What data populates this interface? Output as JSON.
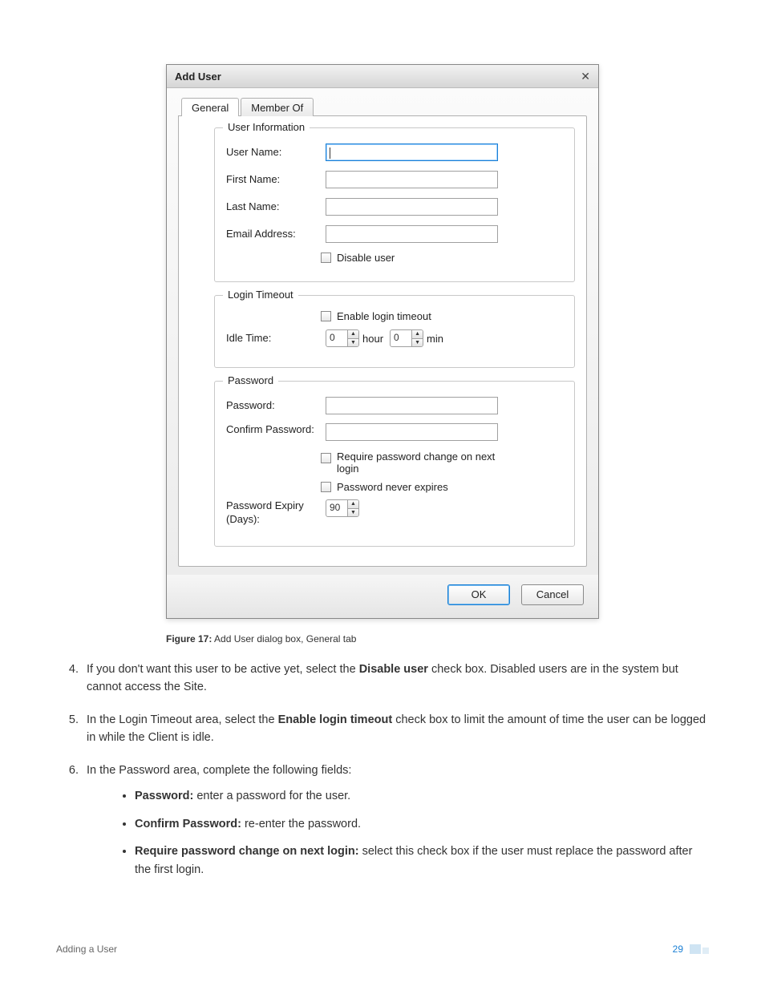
{
  "dialog": {
    "title": "Add User",
    "close_glyph": "✕",
    "tabs": [
      "General",
      "Member Of"
    ],
    "active_tab_index": 0,
    "groups": {
      "user_info": {
        "legend": "User Information",
        "fields": {
          "user_name": {
            "label": "User Name:",
            "value": ""
          },
          "first_name": {
            "label": "First Name:",
            "value": ""
          },
          "last_name": {
            "label": "Last Name:",
            "value": ""
          },
          "email": {
            "label": "Email Address:",
            "value": ""
          }
        },
        "disable_user_label": "Disable user"
      },
      "login_timeout": {
        "legend": "Login Timeout",
        "enable_label": "Enable login timeout",
        "idle_time_label": "Idle Time:",
        "hour_value": "0",
        "hour_unit": "hour",
        "min_value": "0",
        "min_unit": "min"
      },
      "password": {
        "legend": "Password",
        "password_label": "Password:",
        "confirm_label": "Confirm Password:",
        "require_change_label": "Require password change on next login",
        "never_expires_label": "Password never expires",
        "expiry_label": "Password Expiry (Days):",
        "expiry_value": "90"
      }
    },
    "buttons": {
      "ok": "OK",
      "cancel": "Cancel"
    }
  },
  "caption": {
    "label": "Figure 17:",
    "text": "Add User dialog box, General tab"
  },
  "body": {
    "item4_a": "If you don't want this user to be active yet, select the ",
    "item4_b": "Disable user",
    "item4_c": " check box. Disabled users are in the system but cannot access the Site.",
    "item5_a": "In the Login Timeout area, select the ",
    "item5_b": "Enable login timeout",
    "item5_c": " check box to limit the amount of time the user can be logged in while the Client is idle.",
    "item6": "In the Password area, complete the following fields:",
    "bullets": {
      "pw_b": "Password:",
      "pw_t": " enter a password for the user.",
      "cp_b": "Confirm Password:",
      "cp_t": " re-enter the password.",
      "rc_b": "Require password change on next login:",
      "rc_t": " select this check box if the user must replace the password after the first login."
    }
  },
  "footer": {
    "left": "Adding a User",
    "page": "29"
  }
}
